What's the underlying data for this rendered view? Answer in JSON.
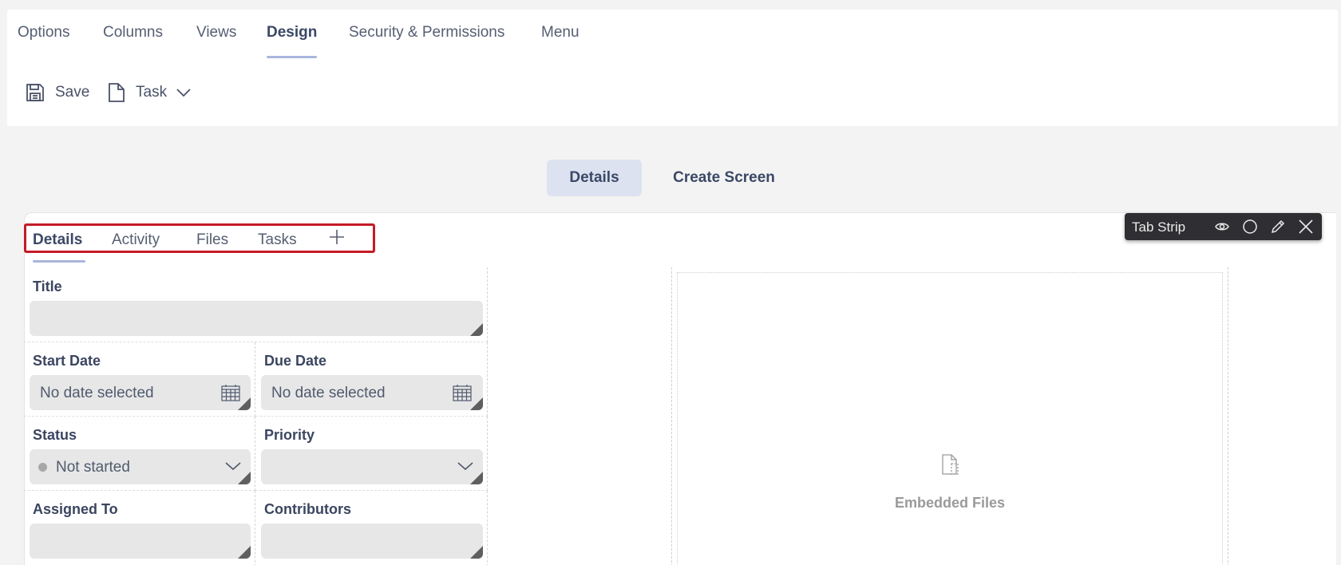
{
  "nav": {
    "tabs": [
      {
        "label": "Options"
      },
      {
        "label": "Columns"
      },
      {
        "label": "Views"
      },
      {
        "label": "Design"
      },
      {
        "label": "Security & Permissions"
      },
      {
        "label": "Menu"
      }
    ],
    "active_tab": "Design"
  },
  "toolbar": {
    "save_label": "Save",
    "content_type_label": "Task"
  },
  "view_switch": {
    "items": [
      {
        "label": "Details"
      },
      {
        "label": "Create Screen"
      }
    ],
    "active": "Details"
  },
  "form_tabs": {
    "items": [
      {
        "label": "Details"
      },
      {
        "label": "Activity"
      },
      {
        "label": "Files"
      },
      {
        "label": "Tasks"
      }
    ],
    "active": "Details"
  },
  "tab_strip_toolbar": {
    "label": "Tab Strip",
    "icons": [
      "eye-icon",
      "circle-icon",
      "pencil-icon",
      "close-icon"
    ]
  },
  "fields": {
    "title": {
      "label": "Title",
      "value": ""
    },
    "start_date": {
      "label": "Start Date",
      "placeholder": "No date selected"
    },
    "due_date": {
      "label": "Due Date",
      "placeholder": "No date selected"
    },
    "status": {
      "label": "Status",
      "value": "Not started"
    },
    "priority": {
      "label": "Priority",
      "value": ""
    },
    "assigned_to": {
      "label": "Assigned To",
      "value": ""
    },
    "contributors": {
      "label": "Contributors",
      "value": ""
    }
  },
  "embedded_files": {
    "label": "Embedded Files"
  },
  "colors": {
    "accent_underline": "#a9b6dc",
    "active_view_bg": "#dde2f1",
    "highlight_border": "#c61a26",
    "tab_strip_bg": "#2f2f33",
    "input_bg": "#e7e7e7"
  }
}
